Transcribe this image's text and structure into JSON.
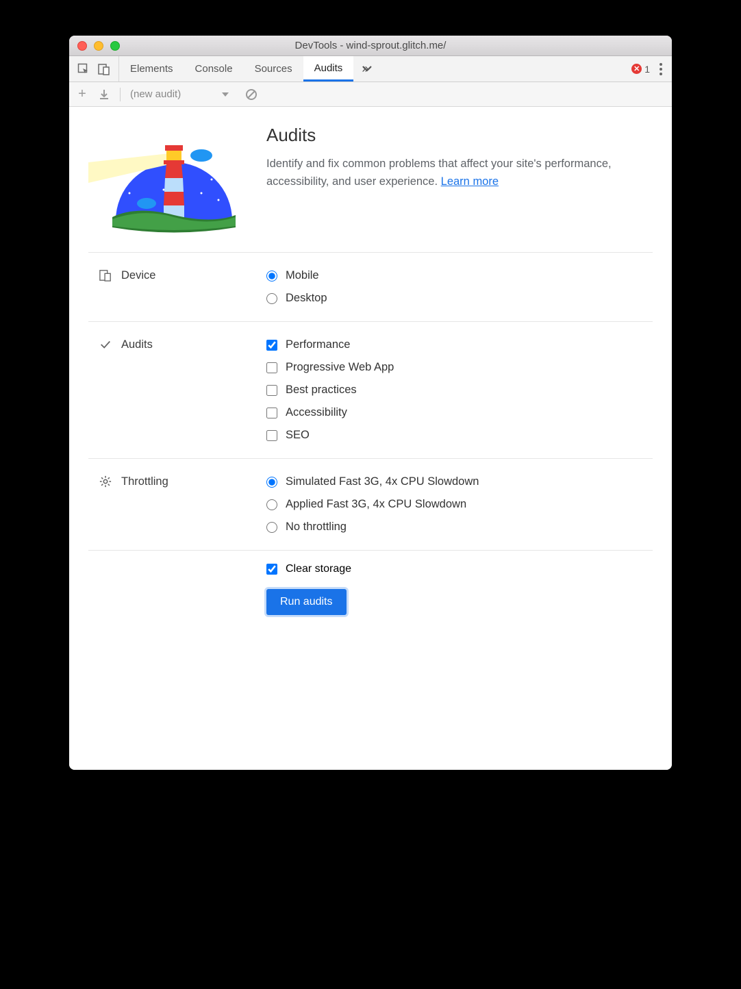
{
  "window": {
    "title": "DevTools - wind-sprout.glitch.me/"
  },
  "tabs": {
    "elements": "Elements",
    "console": "Console",
    "sources": "Sources",
    "audits": "Audits",
    "active": "audits"
  },
  "errors": {
    "count": "1"
  },
  "toolbar": {
    "dropdown_label": "(new audit)"
  },
  "header": {
    "title": "Audits",
    "description_a": "Identify and fix common problems that affect your site's performance, accessibility, and user experience. ",
    "learn_more": "Learn more"
  },
  "sections": {
    "device": {
      "label": "Device",
      "options": [
        {
          "label": "Mobile",
          "checked": true
        },
        {
          "label": "Desktop",
          "checked": false
        }
      ]
    },
    "audits": {
      "label": "Audits",
      "options": [
        {
          "label": "Performance",
          "checked": true
        },
        {
          "label": "Progressive Web App",
          "checked": false
        },
        {
          "label": "Best practices",
          "checked": false
        },
        {
          "label": "Accessibility",
          "checked": false
        },
        {
          "label": "SEO",
          "checked": false
        }
      ]
    },
    "throttling": {
      "label": "Throttling",
      "options": [
        {
          "label": "Simulated Fast 3G, 4x CPU Slowdown",
          "checked": true
        },
        {
          "label": "Applied Fast 3G, 4x CPU Slowdown",
          "checked": false
        },
        {
          "label": "No throttling",
          "checked": false
        }
      ]
    },
    "clear_storage": {
      "label": "Clear storage",
      "checked": true
    }
  },
  "buttons": {
    "run": "Run audits"
  }
}
